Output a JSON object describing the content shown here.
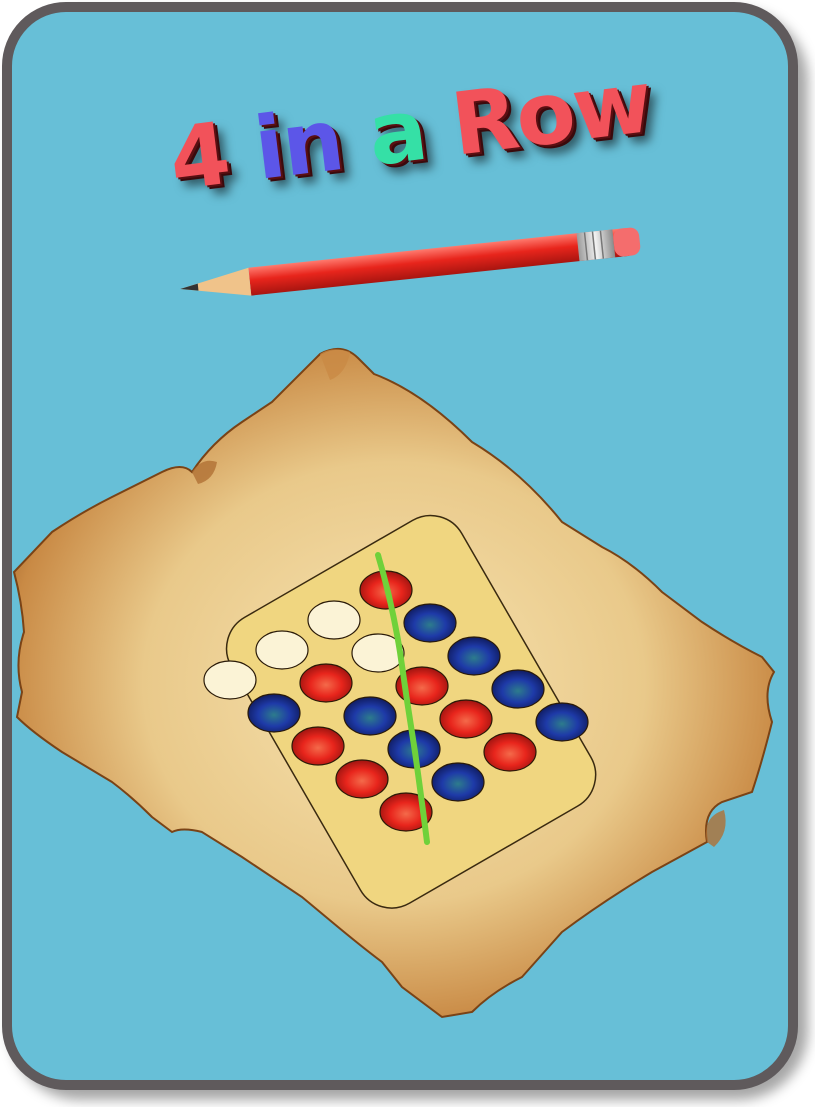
{
  "title": {
    "number": "4",
    "word_in": "in",
    "word_a": "a",
    "word_row": "Row"
  },
  "colors": {
    "background": "#67bfd7",
    "card_border": "#5f5a5c",
    "board": "#f0d680",
    "red_piece": "#e8251c",
    "blue_piece": "#1e3aa8",
    "empty_hole": "#fbf3d6",
    "win_line": "#6fd13a",
    "pencil": "#e8251c"
  },
  "board": {
    "rows": [
      [
        "empty",
        "empty",
        "empty",
        "red"
      ],
      [
        "blue",
        "red",
        "empty",
        "blue"
      ],
      [
        "red",
        "blue",
        "red",
        "blue"
      ],
      [
        "red",
        "blue",
        "red",
        "blue"
      ],
      [
        "red",
        "blue",
        "red",
        "blue"
      ]
    ],
    "winning_line": "vertical"
  }
}
